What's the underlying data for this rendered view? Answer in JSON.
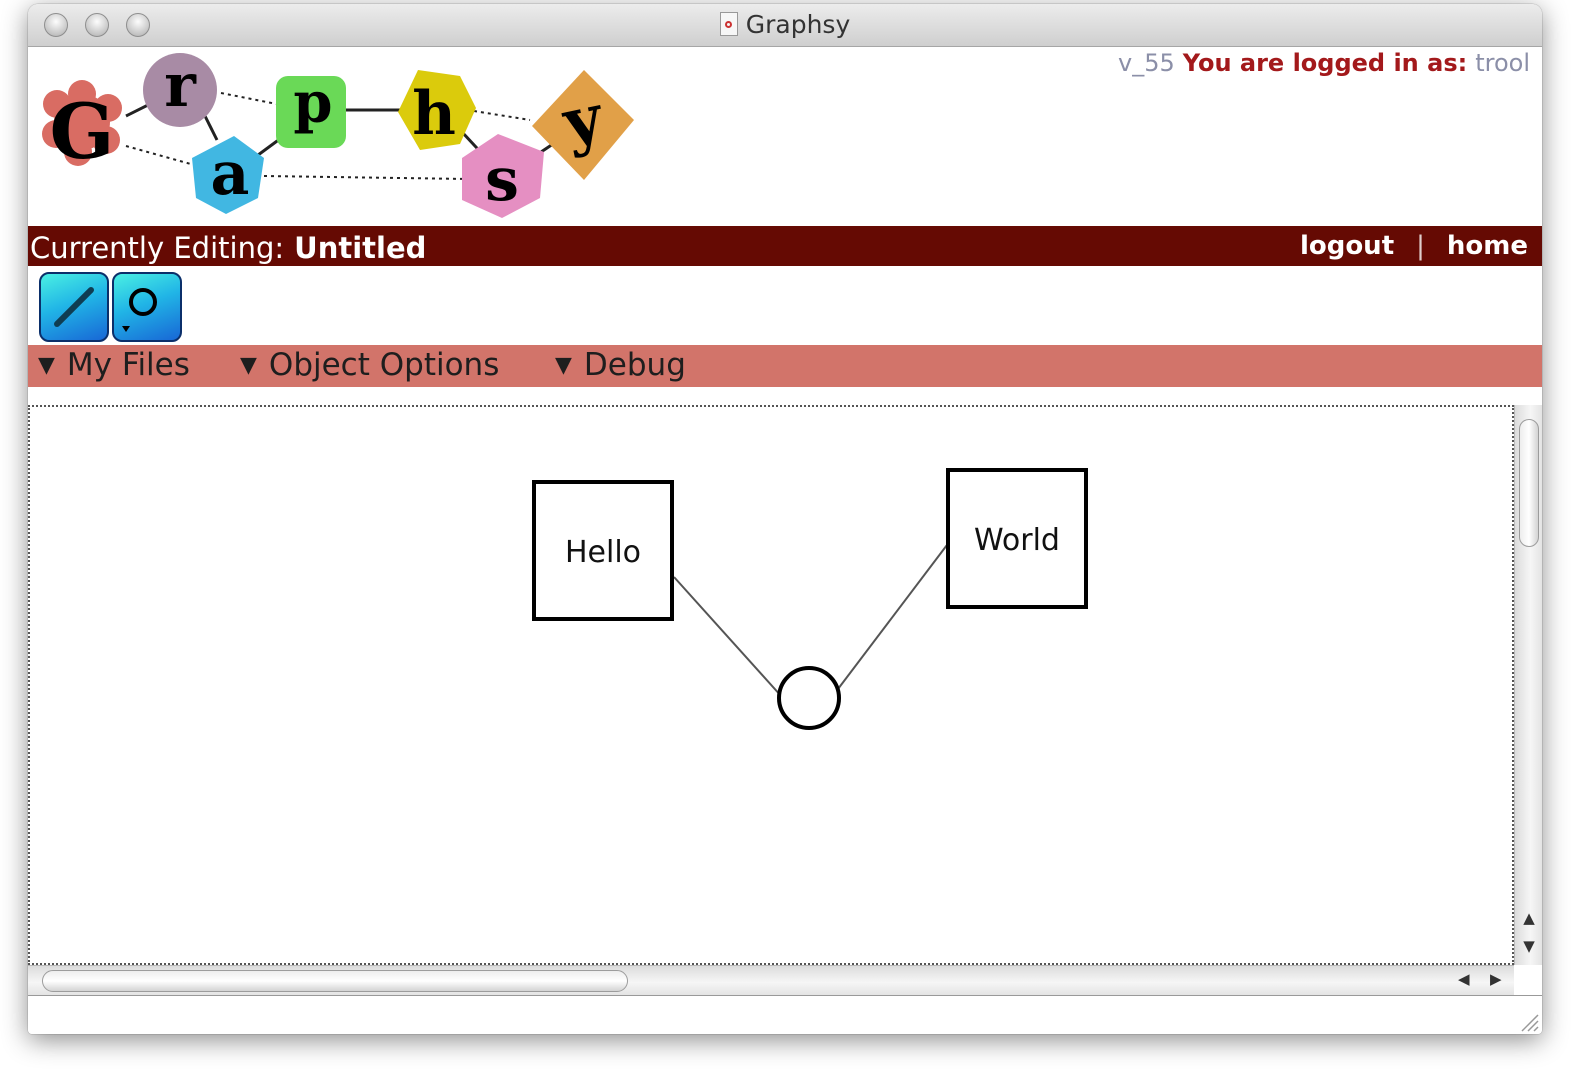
{
  "window": {
    "title": "Graphsy"
  },
  "header": {
    "logo_letters": [
      "G",
      "r",
      "a",
      "p",
      "h",
      "s",
      "y"
    ],
    "version": "v_55",
    "login_label": "You are logged in as:",
    "username": "trool"
  },
  "editbar": {
    "label": "Currently Editing:",
    "document_name": "Untitled",
    "logout": "logout",
    "separator": "|",
    "home": "home"
  },
  "tools": [
    {
      "name": "edge-tool",
      "icon": "line-icon"
    },
    {
      "name": "node-tool",
      "icon": "circle-node-icon"
    }
  ],
  "menus": [
    {
      "label": "My Files"
    },
    {
      "label": "Object Options"
    },
    {
      "label": "Debug"
    }
  ],
  "graph": {
    "nodes": [
      {
        "label": "Hello",
        "shape": "square"
      },
      {
        "label": "World",
        "shape": "square"
      },
      {
        "label": "",
        "shape": "circle"
      }
    ]
  },
  "colors": {
    "editbar_bg": "#650a03",
    "menubar_bg": "#d2746a",
    "login_label": "#a3191b",
    "logo": {
      "G": "#d96c63",
      "r": "#a88ba5",
      "a": "#41b7e2",
      "p": "#6ad957",
      "h": "#dbcb0c",
      "s": "#e58fc2",
      "y": "#e1a048"
    }
  }
}
